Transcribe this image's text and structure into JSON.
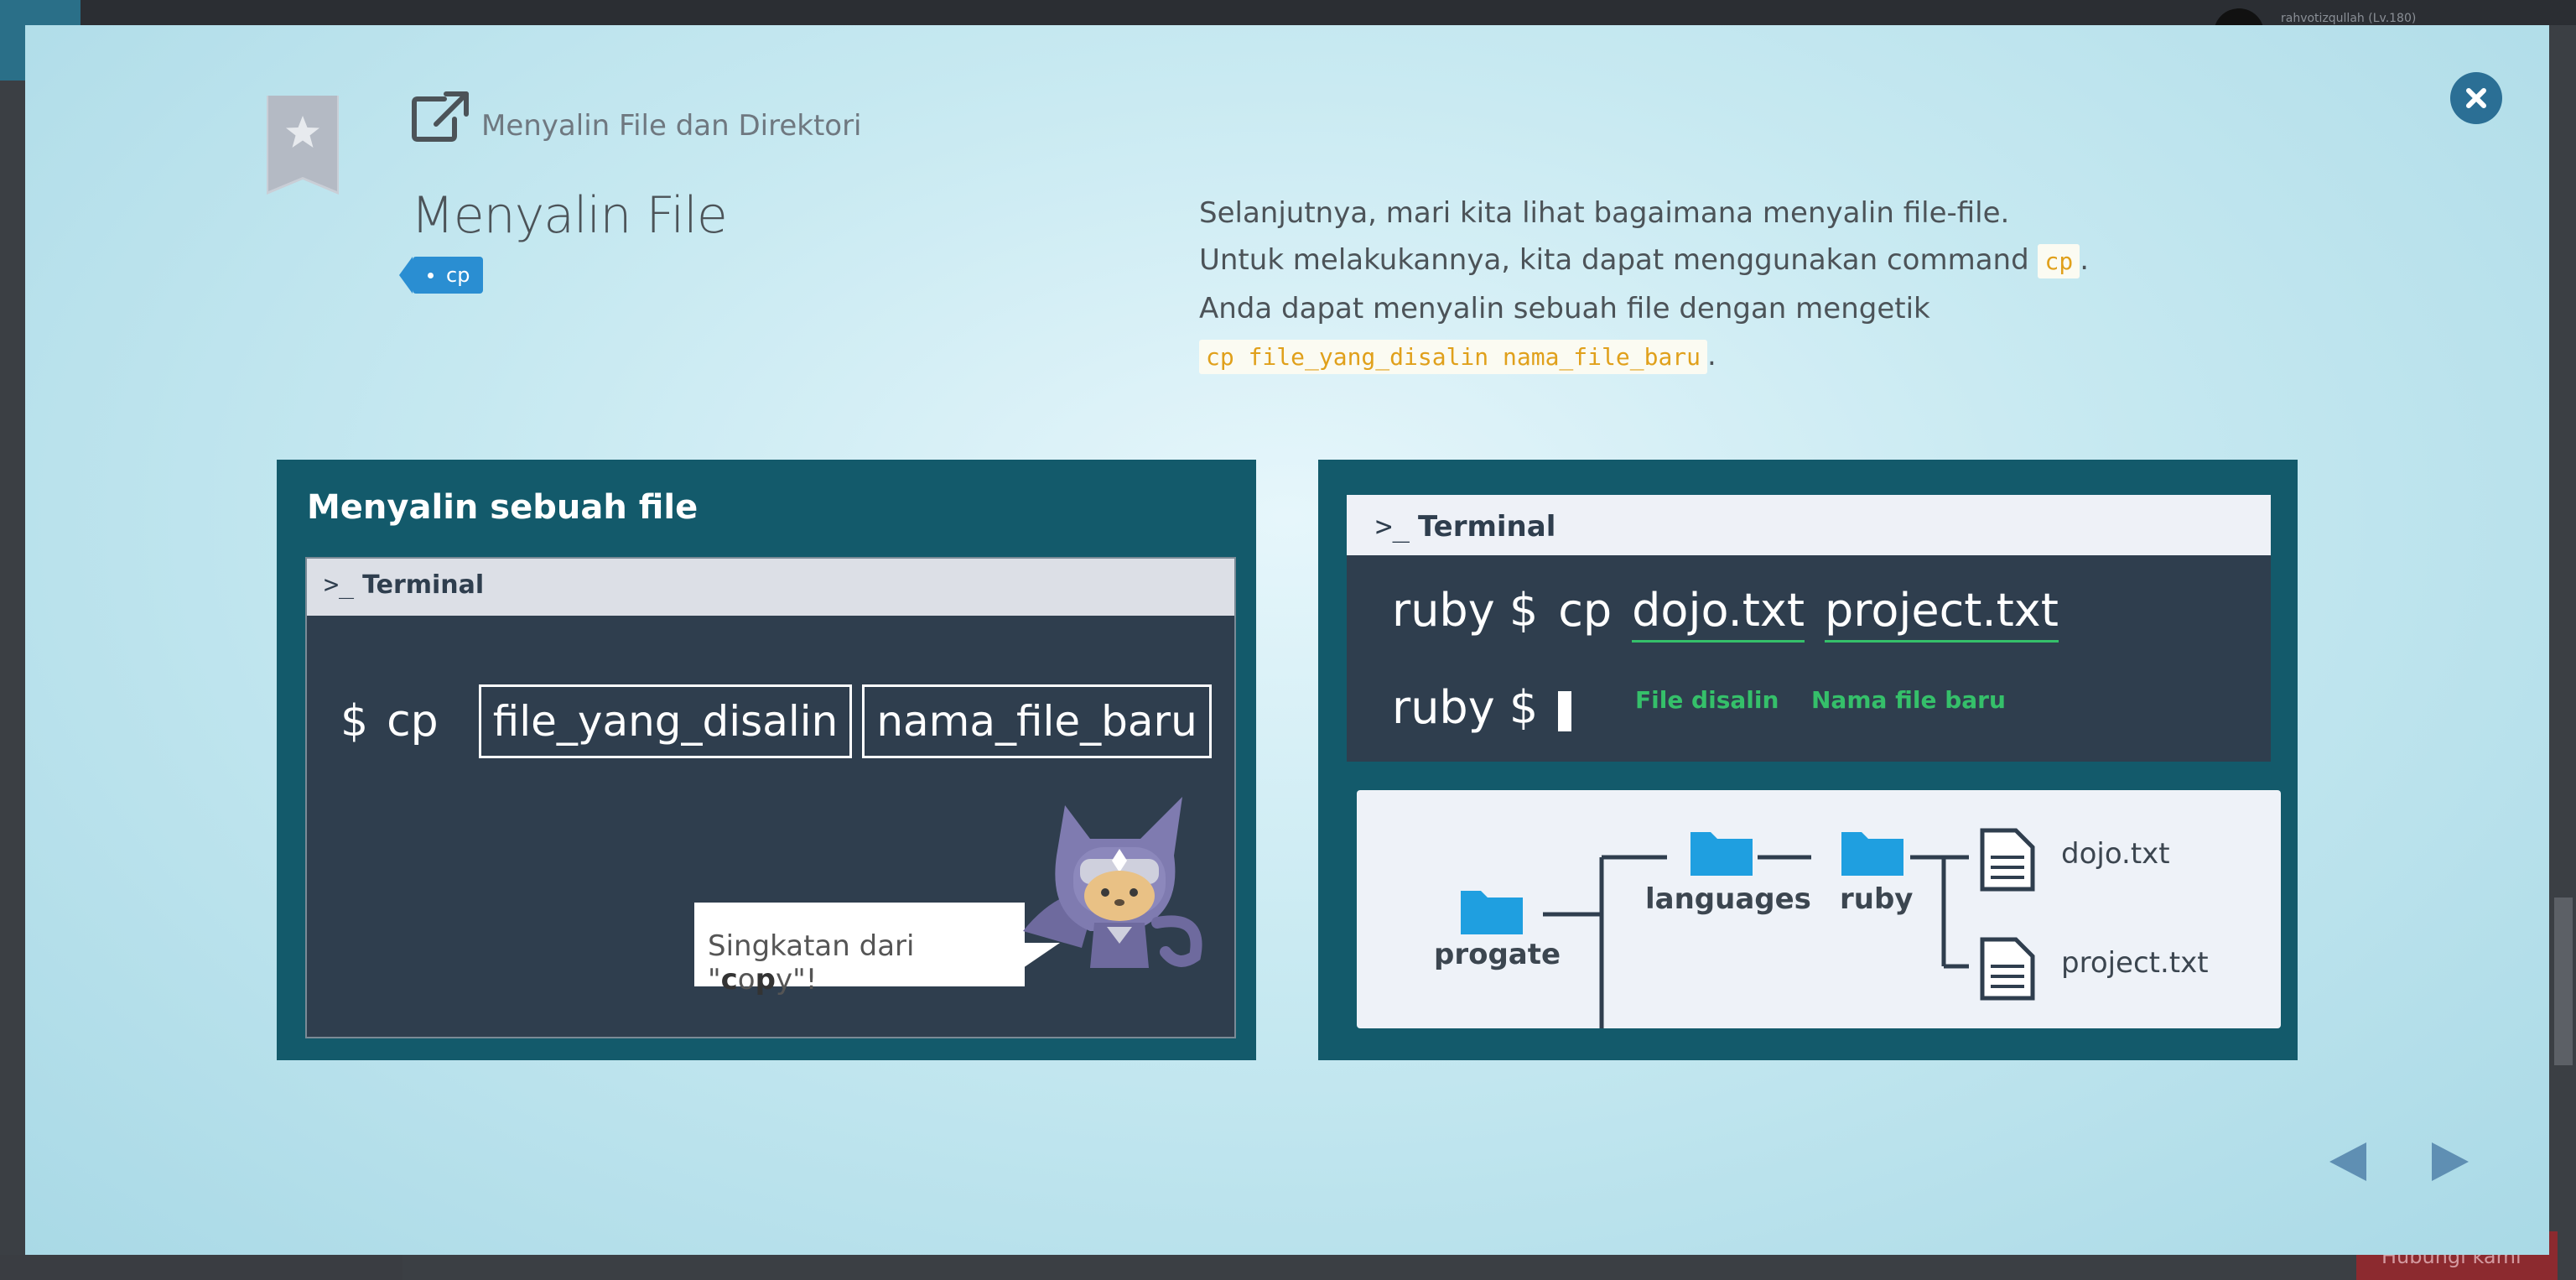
{
  "background": {
    "user_text": "rahvotizqullah (Lv.180)",
    "bottom_button_label": "Hubungi kami"
  },
  "modal": {
    "lesson_link_text": "Menyalin File dan Direktori",
    "slide_title": "Menyalin File",
    "tag_label": "cp",
    "description": {
      "line1": "Selanjutnya, mari kita lihat bagaimana menyalin file-file.",
      "line2_prefix": "Untuk melakukannya, kita dapat menggunakan command ",
      "line2_code": "cp",
      "line2_suffix": ".",
      "line3": "Anda dapat menyalin sebuah file dengan mengetik",
      "line4_code": "cp file_yang_disalin nama_file_baru",
      "line4_suffix": "."
    }
  },
  "left_slide": {
    "title": "Menyalin sebuah file",
    "terminal_prompt": ">_",
    "terminal_title": "Terminal",
    "dollar": "$",
    "command": "cp",
    "arg1": "file_yang_disalin",
    "arg2": "nama_file_baru",
    "bubble_prefix": "Singkatan dari \"",
    "bubble_c": "c",
    "bubble_o": "o",
    "bubble_p": "p",
    "bubble_y": "y",
    "bubble_suffix": "\"!"
  },
  "right_slide": {
    "terminal_prompt": ">_",
    "terminal_title": "Terminal",
    "line1_prompt": "ruby $",
    "line1_cmd": "cp",
    "line1_arg1": "dojo.txt",
    "line1_arg2": "project.txt",
    "label_arg1": "File disalin",
    "label_arg2": "Nama file baru",
    "line2_prompt": "ruby $",
    "tree": {
      "root": "progate",
      "child": "languages",
      "grandchild": "ruby",
      "file1": "dojo.txt",
      "file2": "project.txt"
    }
  },
  "colors": {
    "accent_blue": "#2a8ed2",
    "code_orange": "#e0a01b",
    "panel_teal": "#135a6b",
    "terminal_dark": "#2f3e4e",
    "highlight_green": "#35c06a",
    "folder_blue": "#1f9fe0"
  },
  "icons": {
    "close": "close-icon",
    "bookmark": "bookmark-star-icon",
    "external_link": "external-link-icon",
    "prev": "triangle-left-icon",
    "next": "triangle-right-icon"
  }
}
